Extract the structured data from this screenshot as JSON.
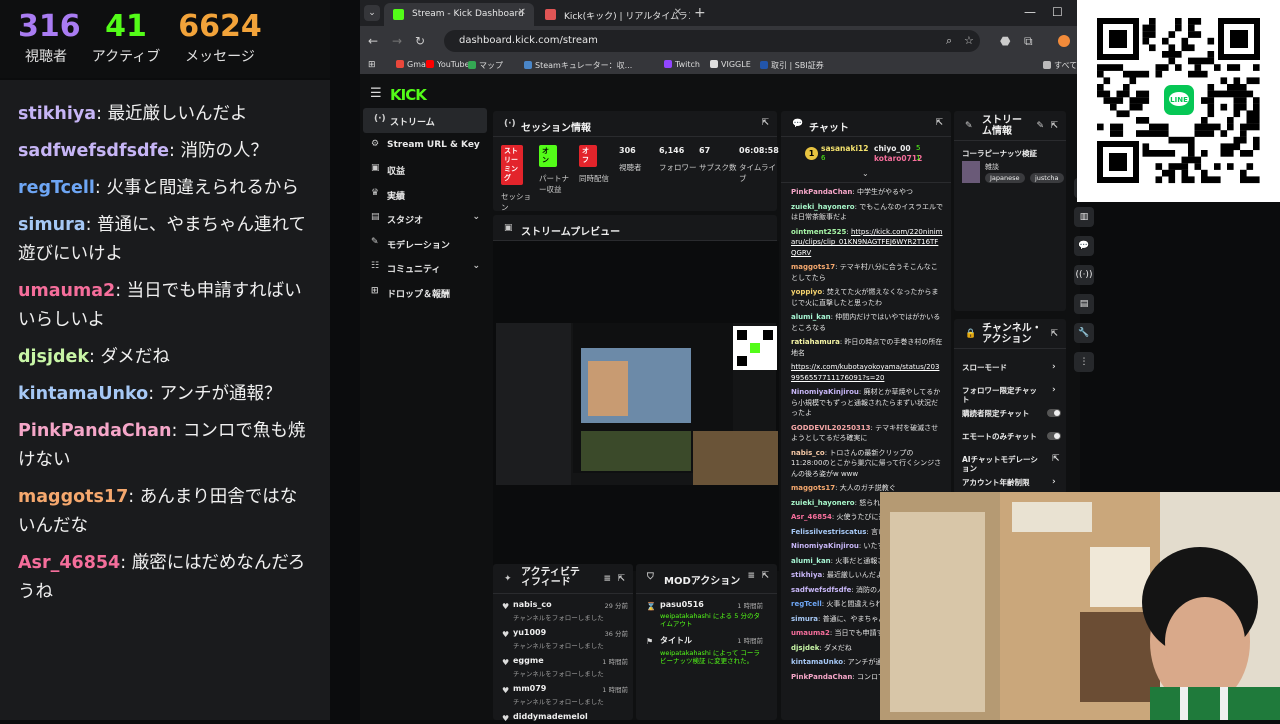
{
  "overlay": {
    "stats": [
      {
        "value": "316",
        "label": "視聴者",
        "color": "#a97cf2"
      },
      {
        "value": "41",
        "label": "アクティブ",
        "color": "#53fc18"
      },
      {
        "value": "6624",
        "label": "メッセージ",
        "color": "#f2a33a"
      }
    ],
    "chat": [
      {
        "user": "stikhiya",
        "text": "最近厳しいんだよ",
        "color": "#c6b5f5"
      },
      {
        "user": "sadfwefsdfsdfe",
        "text": "消防の人？",
        "color": "#c6b5f5"
      },
      {
        "user": "regTcell",
        "text": "火事と間違えられるから",
        "color": "#6ea6f5"
      },
      {
        "user": "simura",
        "text": "普通に、やまちゃん連れて遊びにいけよ",
        "color": "#a6c8f5"
      },
      {
        "user": "umauma2",
        "text": "当日でも申請すればいいらしいよ",
        "color": "#f56e9b"
      },
      {
        "user": "djsjdek",
        "text": "ダメだね",
        "color": "#c8f5a6"
      },
      {
        "user": "kintamaUnko",
        "text": "アンチが通報？",
        "color": "#a6c8f5"
      },
      {
        "user": "PinkPandaChan",
        "text": "コンロで魚も焼けない",
        "color": "#f5a6c8"
      },
      {
        "user": "maggots17",
        "text": "あんまり田舎ではないんだな",
        "color": "#f5a86e"
      },
      {
        "user": "Asr_46854",
        "text": "厳密にはだめなんだろうね",
        "color": "#f56e9b"
      }
    ]
  },
  "browser": {
    "tabs": [
      {
        "title": "Stream - Kick Dashboard",
        "active": true,
        "fav_color": "#53fc18"
      },
      {
        "title": "Kick(キック) | リアルタイムランキング",
        "active": false,
        "fav_color": "#e05555"
      }
    ],
    "new_tab": "+",
    "url": "dashboard.kick.com/stream",
    "bookmarks": [
      {
        "label": "Gmail",
        "color": "#e9473b"
      },
      {
        "label": "YouTube",
        "color": "#ff0000"
      },
      {
        "label": "マップ",
        "color": "#34a853"
      },
      {
        "label": "Steamキュレーター：収...",
        "color": "#4a86c8"
      },
      {
        "label": "Twitch",
        "color": "#9146ff"
      },
      {
        "label": "VIGGLE",
        "color": "#dddddd"
      },
      {
        "label": "取引 | SBI証券",
        "color": "#2255aa"
      },
      {
        "label": "すべてのブック",
        "color": "#bbbbbb"
      }
    ]
  },
  "kick": {
    "logo": "KICK",
    "sidebar": [
      {
        "label": "ストリーム",
        "icon": "(·)",
        "active": true,
        "chev": false
      },
      {
        "label": "Stream URL & Key",
        "icon": "⚙",
        "active": false,
        "chev": false
      },
      {
        "label": "収益",
        "icon": "▣",
        "active": false,
        "chev": false
      },
      {
        "label": "実績",
        "icon": "♛",
        "active": false,
        "chev": false
      },
      {
        "label": "スタジオ",
        "icon": "▤",
        "active": false,
        "chev": true
      },
      {
        "label": "モデレーション",
        "icon": "✎",
        "active": false,
        "chev": false
      },
      {
        "label": "コミュニティ",
        "icon": "☷",
        "active": false,
        "chev": true
      },
      {
        "label": "ドロップ＆報酬",
        "icon": "⊞",
        "active": false,
        "chev": false
      }
    ],
    "session": {
      "title": "セッション情報",
      "cells": [
        {
          "badge": "ストリーミング",
          "badge_bg": "#e3242b",
          "badge_fg": "#ffffff",
          "label": "セッション"
        },
        {
          "badge": "オン",
          "badge_bg": "#53fc18",
          "badge_fg": "#000000",
          "label": "パートナー収益"
        },
        {
          "badge": "オフ",
          "badge_bg": "#e3242b",
          "badge_fg": "#ffffff",
          "label": "同時配信"
        },
        {
          "value": "306",
          "label": "視聴者"
        },
        {
          "value": "6,146",
          "label": "フォロワー"
        },
        {
          "value": "67",
          "label": "サブスク数"
        },
        {
          "value": "06:08:58",
          "label": "タイムライブ"
        }
      ]
    },
    "preview": {
      "title": "ストリームプレビュー"
    },
    "activity": {
      "title": "アクティビティフィード",
      "items": [
        {
          "user": "nabis_co",
          "desc": "チャンネルをフォローしました",
          "time": "29 分前"
        },
        {
          "user": "yu1009",
          "desc": "チャンネルをフォローしました",
          "time": "36 分前"
        },
        {
          "user": "eggme",
          "desc": "チャンネルをフォローしました",
          "time": "1 時間前"
        },
        {
          "user": "mm079",
          "desc": "チャンネルをフォローしました",
          "time": "1 時間前"
        },
        {
          "user": "diddymademelol",
          "desc": "",
          "time": ""
        }
      ]
    },
    "mod": {
      "title": "MODアクション",
      "items": [
        {
          "title": "pasu0516",
          "desc": "weipatakahashi による 5 分のタイムアウト",
          "time": "1 時間前",
          "icon": "⌛"
        },
        {
          "title": "タイトル",
          "desc": "weipatakahashi によって コーラビーナッツ検証 に変更された。",
          "time": "1 時間前",
          "icon": "⚑"
        }
      ]
    },
    "chat": {
      "title": "チャット",
      "top": [
        {
          "name": "sasanaki12",
          "count": "6"
        },
        {
          "name": "chiyo_00",
          "count": "5"
        },
        {
          "name": "kotaro0712",
          "count": "1"
        }
      ],
      "messages": [
        {
          "user": "PinkPandaChan",
          "text": "中学生がやるやつ",
          "color": "#f5a6c8"
        },
        {
          "user": "zuieki_hayonero",
          "text": "でもこんなのイスラエルでは日常茶飯事だよ",
          "color": "#a6f5c8"
        },
        {
          "user": "ointment2525",
          "text": "https://kick.com/220ninimaru/clips/clip_01KN9NAGTFEJ6WYR2T16TFQGRV",
          "color": "#a6f5a6",
          "link": true
        },
        {
          "user": "maggots17",
          "text": "テマキ村八分に合うそこんなことしてたら",
          "color": "#f5a86e"
        },
        {
          "user": "yoppiyo",
          "text": "焚えてた火が燃えなくなったからまじで火に直撃したと思ったわ",
          "color": "#f5d36e"
        },
        {
          "user": "alumi_kan",
          "text": "仲間内だけではいやではがかいるところなる",
          "color": "#a6f5d3"
        },
        {
          "user": "ratiahamura",
          "text": "昨日の時点での手巻き村の所在地名",
          "color": "#f5f5a6"
        },
        {
          "user": "",
          "text": "https://x.com/kubotayokoyama/status/2039956557711176091?s=20",
          "color": "#ffffff",
          "link": true
        },
        {
          "user": "NinomiyaKinjirou",
          "text": "廃材とか草焼やしてるから小規模でもずっと通報されたらまずい状況だったよ",
          "color": "#c6b5f5"
        },
        {
          "user": "GODDEVIL20250313",
          "text": "テマキ村を破滅させようとしてるだろ確実に",
          "color": "#f5a6a6"
        },
        {
          "user": "nabis_co",
          "text": "トロさんの最新クリップの11:28:00のとこから巣穴に帰って行くシンジさんの後ろ姿がw www",
          "color": "#f5c8a6"
        },
        {
          "user": "maggots17",
          "text": "大人のガチ説教ぐ",
          "color": "#f5a86e"
        },
        {
          "user": "zuieki_hayonero",
          "text": "怒られてる",
          "color": "#a6f5c8"
        },
        {
          "user": "Asr_46854",
          "text": "火使うたびに通報",
          "color": "#f56e9b"
        },
        {
          "user": "Felissilvestriscatus",
          "text": "言い訳",
          "color": "#a6c8f5"
        },
        {
          "user": "NinomiyaKinjirou",
          "text": "いたず",
          "color": "#c6b5f5"
        },
        {
          "user": "alumi_kan",
          "text": "火事だと通報され",
          "color": "#a6f5d3"
        },
        {
          "user": "stikhiya",
          "text": "最近厳しいんだよ",
          "color": "#c6b5f5"
        },
        {
          "user": "sadfwefsdfsdfe",
          "text": "消防の人？",
          "color": "#c6b5f5"
        },
        {
          "user": "regTcell",
          "text": "火事と間違えられる",
          "color": "#6ea6f5"
        },
        {
          "user": "simura",
          "text": "普通に、やまちゃん",
          "color": "#a6c8f5"
        },
        {
          "user": "umauma2",
          "text": "当日でも申請すれ",
          "color": "#f56e9b"
        },
        {
          "user": "djsjdek",
          "text": "ダメだね",
          "color": "#c8f5a6"
        },
        {
          "user": "kintamaUnko",
          "text": "アンチが通報",
          "color": "#a6c8f5"
        },
        {
          "user": "PinkPandaChan",
          "text": "コンロで魚",
          "color": "#f5a6c8"
        }
      ]
    },
    "stream_info": {
      "title": "ストリーム情報",
      "stream_title": "コーラピーナッツ検証",
      "category": "雑談",
      "tags": [
        "Japanese",
        "justcha"
      ]
    },
    "channel_actions": {
      "title": "チャンネル・アクション",
      "rows": [
        {
          "label": "スローモード",
          "type": "arrow"
        },
        {
          "label": "フォロワー限定チャット",
          "type": "arrow"
        },
        {
          "label": "購読者限定チャット",
          "type": "switch"
        },
        {
          "label": "エモートのみチャット",
          "type": "switch"
        },
        {
          "label": "AIチャットモデレーション",
          "type": "ext"
        },
        {
          "label": "アカウント年齢制限",
          "type": "arrow"
        }
      ]
    },
    "rail": [
      "⚡",
      "▥",
      "💬",
      "((·))",
      "▤",
      "🔧",
      "⋮"
    ]
  }
}
